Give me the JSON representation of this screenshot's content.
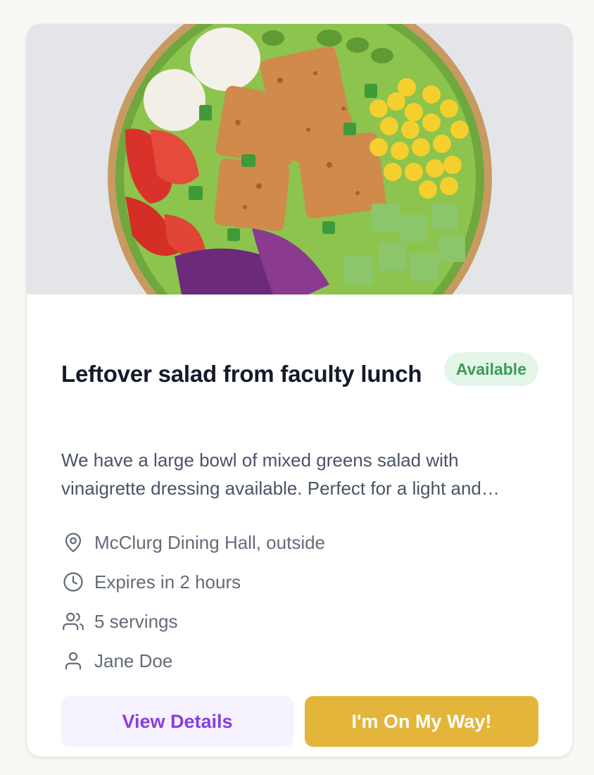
{
  "card": {
    "image_alt": "Salad bowl with tofu, corn, tomatoes, eggs, cucumber and red cabbage",
    "title": "Leftover salad from faculty lunch",
    "status": "Available",
    "description": "We have a large bowl of mixed greens salad with vinaigrette dressing available. Perfect for a light and healthy meal.",
    "meta": [
      {
        "icon": "location-pin-icon",
        "text": "McClurg Dining Hall, outside"
      },
      {
        "icon": "clock-icon",
        "text": "Expires in 2 hours"
      },
      {
        "icon": "users-icon",
        "text": "5 servings"
      },
      {
        "icon": "user-icon",
        "text": "Jane Doe"
      }
    ],
    "actions": {
      "details_label": "View Details",
      "claim_label": "I'm On My Way!"
    }
  },
  "colors": {
    "title": "#151a2b",
    "text": "#4a5366",
    "meta": "#646b78",
    "badge_bg": "#e4f6e9",
    "badge_text": "#3d9a56",
    "details_bg": "#f6f2fe",
    "details_text": "#8a3ce0",
    "accent": "#e3b53b"
  }
}
